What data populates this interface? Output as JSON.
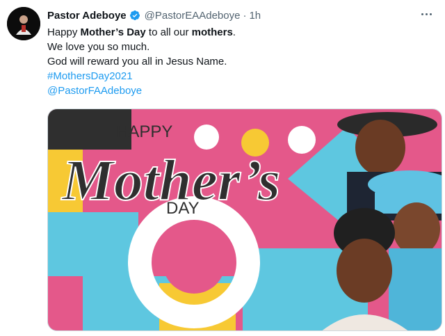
{
  "tweet": {
    "author_name": "Pastor Adeboye",
    "handle": "@PastorEAAdeboye",
    "separator": "·",
    "time": "1h",
    "line1": {
      "pre": "Happy ",
      "bold1": "Mother’s Day",
      "mid": " to all our ",
      "bold2": "mothers",
      "post": "."
    },
    "line2": "We love you so much.",
    "line3": "God will reward you all in Jesus Name.",
    "hashtag": "#MothersDay2021",
    "mention": "@PastorFAAdeboye"
  },
  "graphic": {
    "happy": "HAPPY",
    "mothers": "Mother’s",
    "day": "DAY"
  },
  "icons": {
    "verified": "verified-badge-icon",
    "more": "more-options-icon"
  },
  "colors": {
    "link": "#1d9bf0",
    "verified": "#1d9bf0",
    "pink": "#e4588a",
    "cyan": "#5ec7e0",
    "yellow": "#f7c934",
    "dark": "#2f2f2f"
  }
}
